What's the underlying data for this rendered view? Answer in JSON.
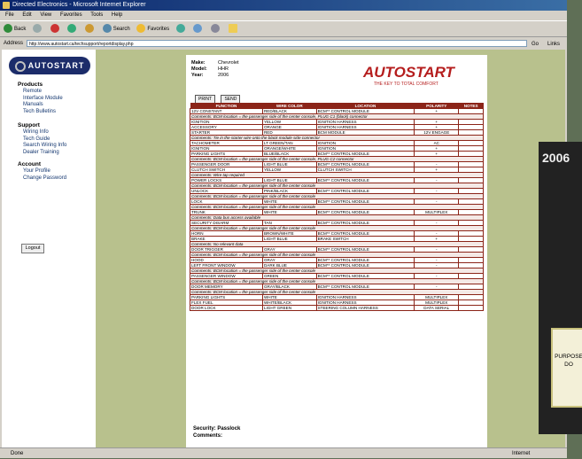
{
  "window": {
    "title": "Directed Electronics - Microsoft Internet Explorer"
  },
  "menu": [
    "File",
    "Edit",
    "View",
    "Favorites",
    "Tools",
    "Help"
  ],
  "toolbar": {
    "back": "Back",
    "search": "Search",
    "favorites": "Favorites"
  },
  "address": {
    "label": "Address",
    "url": "http://www.autostart.ca/techsupport/reportdisplay.php",
    "go": "Go",
    "links": "Links"
  },
  "sidebar": {
    "logo": "AUTOSTART",
    "sections": [
      {
        "title": "Products",
        "items": [
          "Remote",
          "Interface Module",
          "Manuals",
          "Tech Bulletins"
        ]
      },
      {
        "title": "Support",
        "items": [
          "Wiring Info",
          "Tech Guide",
          "Search Wiring Info",
          "Dealer Training"
        ]
      },
      {
        "title": "Account",
        "items": [
          "Your Profile",
          "Change Password"
        ]
      }
    ],
    "logout": "Logout"
  },
  "doc": {
    "meta": [
      {
        "k": "Make:",
        "v": "Chevrolet"
      },
      {
        "k": "Model:",
        "v": "HHR"
      },
      {
        "k": "Year:",
        "v": "2006"
      }
    ],
    "brand": "AUTOSTART",
    "tagline": "THE KEY TO TOTAL COMFORT",
    "buttons": [
      "PRINT",
      "SEND"
    ],
    "headers": [
      "FUNCTION",
      "WIRE COLOR",
      "LOCATION",
      "POLARITY",
      "NOTES"
    ],
    "rows": [
      {
        "type": "row",
        "c": [
          "12V CONSTANT",
          "RED/BLACK",
          "BCM** CONTROL MODULE",
          "+",
          ""
        ]
      },
      {
        "type": "note",
        "text": "Comments: BCM location = the passenger side of the center console, PLUG C1 (black) connector"
      },
      {
        "type": "row",
        "c": [
          "IGNITION",
          "YELLOW",
          "IGNITION HARNESS",
          "+",
          ""
        ]
      },
      {
        "type": "row",
        "c": [
          "ACCESSORY",
          "ORANGE",
          "IGNITION HARNESS",
          "+",
          ""
        ]
      },
      {
        "type": "row",
        "c": [
          "STARTER",
          "RED",
          "BCM MODULE",
          "12V ENGAGE",
          ""
        ]
      },
      {
        "type": "note",
        "text": "Comments: Tie in the starter wire onto the black module side connector"
      },
      {
        "type": "row",
        "c": [
          "TACHOMETER",
          "LT GREEN/TAN",
          "IGNITION",
          "AC",
          ""
        ]
      },
      {
        "type": "row",
        "c": [
          "IGNITION",
          "ORANGE/WHITE",
          "IGNITION",
          "+",
          ""
        ]
      },
      {
        "type": "row",
        "c": [
          "PARKING LIGHTS",
          "BLUE/BLACK",
          "BCM** CONTROL MODULE",
          "+",
          ""
        ]
      },
      {
        "type": "note",
        "text": "Comments: BCM location = the passenger side of the center console, PLUG C2 connector"
      },
      {
        "type": "row",
        "c": [
          "PASSENGER DOOR",
          "LIGHT BLUE",
          "BCM** CONTROL MODULE",
          "-",
          ""
        ]
      },
      {
        "type": "row",
        "c": [
          "CLUTCH SWITCH",
          "YELLOW",
          "CLUTCH SWITCH",
          "+",
          ""
        ]
      },
      {
        "type": "note",
        "text": "Comments: Wire tap required"
      },
      {
        "type": "row",
        "c": [
          "POWER LOCKS",
          "LIGHT BLUE",
          "BCM** CONTROL MODULE",
          "-",
          ""
        ]
      },
      {
        "type": "note",
        "text": "Comments: BCM location = the passenger side of the center console"
      },
      {
        "type": "row",
        "c": [
          "UNLOCK",
          "PINK/BLACK",
          "BCM** CONTROL MODULE",
          "-",
          ""
        ]
      },
      {
        "type": "note",
        "text": "Comments: BCM location = the passenger side of the center console"
      },
      {
        "type": "row",
        "c": [
          "LOCK",
          "WHITE",
          "BCM** CONTROL MODULE",
          "-",
          ""
        ]
      },
      {
        "type": "note",
        "text": "Comments: BCM location = the passenger side of the center console"
      },
      {
        "type": "row",
        "c": [
          "TRUNK",
          "WHITE",
          "BCM** CONTROL MODULE",
          "MULTIPLEX",
          ""
        ]
      },
      {
        "type": "note",
        "text": "Comments: Data bus access available"
      },
      {
        "type": "row",
        "c": [
          "SECURITY DISARM",
          "TAN",
          "BCM** CONTROL MODULE",
          "-",
          ""
        ]
      },
      {
        "type": "note",
        "text": "Comments: BCM location = the passenger side of the center console"
      },
      {
        "type": "row",
        "c": [
          "HORN",
          "BROWN/WHITE",
          "BCM** CONTROL MODULE",
          "-",
          ""
        ]
      },
      {
        "type": "row",
        "c": [
          "BRAKE",
          "LIGHT BLUE",
          "BRAKE SWITCH",
          "+",
          ""
        ]
      },
      {
        "type": "note",
        "text": "Comments: No relevant data"
      },
      {
        "type": "row",
        "c": [
          "DOOR TRIGGER",
          "GRAY",
          "BCM** CONTROL MODULE",
          "-",
          ""
        ]
      },
      {
        "type": "note",
        "text": "Comments: BCM location = the passenger side of the center console"
      },
      {
        "type": "row",
        "c": [
          "HOOD",
          "GRAY",
          "BCM** CONTROL MODULE",
          "-",
          ""
        ]
      },
      {
        "type": "row",
        "c": [
          "LEFT FRONT WINDOW",
          "DARK BLUE",
          "BCM** CONTROL MODULE",
          "-",
          ""
        ]
      },
      {
        "type": "note",
        "text": "Comments: BCM location = the passenger side of the center console"
      },
      {
        "type": "row",
        "c": [
          "PASSENGER WINDOW",
          "GREEN",
          "BCM** CONTROL MODULE",
          "-",
          ""
        ]
      },
      {
        "type": "note",
        "text": "Comments: BCM location = the passenger side of the center console"
      },
      {
        "type": "row",
        "c": [
          "DOOR MEMORY",
          "GRAY/BLACK",
          "BCM** CONTROL MODULE",
          "-",
          ""
        ]
      },
      {
        "type": "note",
        "text": "Comments: BCM location = the passenger side of the center console"
      },
      {
        "type": "row",
        "c": [
          "PARKING LIGHTS",
          "WHITE",
          "IGNITION HARNESS",
          "MULTIPLEX",
          ""
        ]
      },
      {
        "type": "row",
        "c": [
          "FLEX FUEL",
          "WHITE/BLACK",
          "IGNITION HARNESS",
          "MULTIPLEX",
          ""
        ]
      },
      {
        "type": "row",
        "c": [
          "DOOR LOCK",
          "LIGHT GREEN",
          "STEERING COLUMN HARNESS",
          "DATA SERIAL",
          ""
        ]
      }
    ],
    "footer": [
      "Security: Passlock",
      "Comments:"
    ]
  },
  "ad": {
    "year": "2006",
    "text": "PURPOSE DO"
  },
  "status": {
    "left": "Done",
    "zone": "Internet"
  }
}
